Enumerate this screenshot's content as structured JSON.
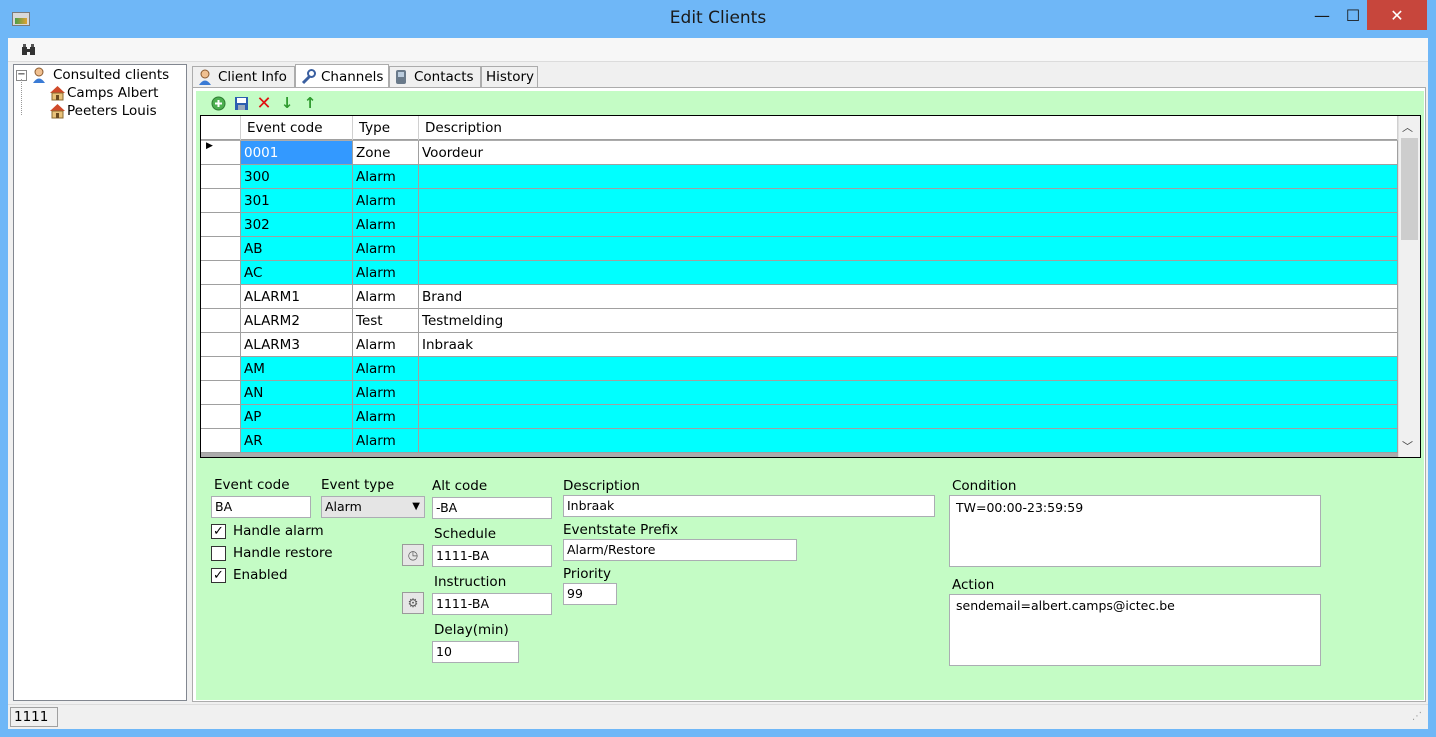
{
  "window": {
    "title": "Edit Clients",
    "minimize": "—",
    "maximize": "☐",
    "close": "✕"
  },
  "tree": {
    "root": "Consulted clients",
    "children": [
      "Camps Albert",
      "Peeters Louis"
    ]
  },
  "tabs": [
    "Client Info",
    "Channels",
    "Contacts",
    "History"
  ],
  "grid": {
    "columns": [
      "Event code",
      "Type",
      "Description"
    ],
    "rows": [
      {
        "code": "0001",
        "type": "Zone",
        "desc": "Voordeur",
        "color": "#ffffff",
        "selected": true
      },
      {
        "code": "300",
        "type": "Alarm",
        "desc": "",
        "color": "#00ffff"
      },
      {
        "code": "301",
        "type": "Alarm",
        "desc": "",
        "color": "#00ffff"
      },
      {
        "code": "302",
        "type": "Alarm",
        "desc": "",
        "color": "#00ffff"
      },
      {
        "code": "AB",
        "type": "Alarm",
        "desc": "",
        "color": "#00ffff"
      },
      {
        "code": "AC",
        "type": "Alarm",
        "desc": "",
        "color": "#00ffff"
      },
      {
        "code": "ALARM1",
        "type": "Alarm",
        "desc": "Brand",
        "color": "#ffffff"
      },
      {
        "code": "ALARM2",
        "type": "Test",
        "desc": "Testmelding",
        "color": "#ffffff"
      },
      {
        "code": "ALARM3",
        "type": "Alarm",
        "desc": "Inbraak",
        "color": "#ffffff"
      },
      {
        "code": "AM",
        "type": "Alarm",
        "desc": "",
        "color": "#00ffff"
      },
      {
        "code": "AN",
        "type": "Alarm",
        "desc": "",
        "color": "#00ffff"
      },
      {
        "code": "AP",
        "type": "Alarm",
        "desc": "",
        "color": "#00ffff"
      },
      {
        "code": "AR",
        "type": "Alarm",
        "desc": "",
        "color": "#00ffff"
      }
    ]
  },
  "form": {
    "event_code_label": "Event code",
    "event_code": "BA",
    "event_type_label": "Event type",
    "event_type": "Alarm",
    "handle_alarm_label": "Handle alarm",
    "handle_restore_label": "Handle restore",
    "enabled_label": "Enabled",
    "alt_code_label": "Alt code",
    "alt_code": "-BA",
    "schedule_label": "Schedule",
    "schedule": "1111-BA",
    "instruction_label": "Instruction",
    "instruction": "1111-BA",
    "delay_label": "Delay(min)",
    "delay": "10",
    "description_label": "Description",
    "description": "Inbraak",
    "prefix_label": "Eventstate Prefix",
    "prefix": "Alarm/Restore",
    "priority_label": "Priority",
    "priority": "99",
    "condition_label": "Condition",
    "condition": "TW=00:00-23:59:59",
    "action_label": "Action",
    "action": "sendemail=albert.camps@ictec.be"
  },
  "status": {
    "text": "1111"
  },
  "colors": {
    "highlight": "#00ffff",
    "selected": "#3399ff",
    "panel": "#c4fcc5"
  }
}
